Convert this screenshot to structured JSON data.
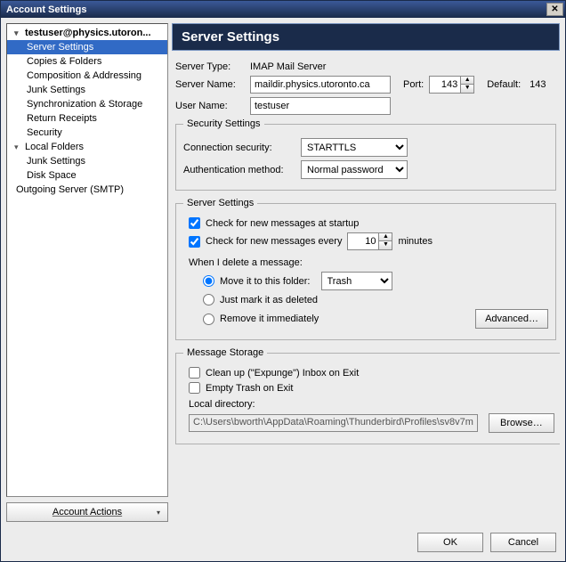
{
  "window": {
    "title": "Account Settings",
    "close": "✕"
  },
  "sidebar": {
    "items": [
      {
        "label": "testuser@physics.utoron...",
        "parent": true
      },
      {
        "label": "Server Settings",
        "selected": true
      },
      {
        "label": "Copies & Folders"
      },
      {
        "label": "Composition & Addressing"
      },
      {
        "label": "Junk Settings"
      },
      {
        "label": "Synchronization & Storage"
      },
      {
        "label": "Return Receipts"
      },
      {
        "label": "Security"
      },
      {
        "label": "Local Folders",
        "parent": true
      },
      {
        "label": "Junk Settings"
      },
      {
        "label": "Disk Space"
      },
      {
        "label": "Outgoing Server (SMTP)",
        "top": true
      }
    ],
    "account_actions": "Account Actions"
  },
  "panel": {
    "title": "Server Settings",
    "server_type_label": "Server Type:",
    "server_type_value": "IMAP Mail Server",
    "server_name_label": "Server Name:",
    "server_name_value": "maildir.physics.utoronto.ca",
    "port_label": "Port:",
    "port_value": "143",
    "default_label": "Default:",
    "default_value": "143",
    "user_name_label": "User Name:",
    "user_name_value": "testuser",
    "security": {
      "legend": "Security Settings",
      "conn_label": "Connection security:",
      "conn_value": "STARTTLS",
      "auth_label": "Authentication method:",
      "auth_value": "Normal password"
    },
    "server": {
      "legend": "Server Settings",
      "check_startup": "Check for new messages at startup",
      "check_every_prefix": "Check for new messages every",
      "check_every_value": "10",
      "check_every_suffix": "minutes",
      "delete_label": "When I delete a message:",
      "opt_move": "Move it to this folder:",
      "opt_move_value": "Trash",
      "opt_mark": "Just mark it as deleted",
      "opt_remove": "Remove it immediately",
      "advanced": "Advanced…"
    },
    "storage": {
      "legend": "Message Storage",
      "expunge": "Clean up (\"Expunge\") Inbox on Exit",
      "empty_trash": "Empty Trash on Exit",
      "local_dir_label": "Local directory:",
      "local_dir_value": "C:\\Users\\bworth\\AppData\\Roaming\\Thunderbird\\Profiles\\sv8v7m",
      "browse": "Browse…"
    }
  },
  "footer": {
    "ok": "OK",
    "cancel": "Cancel"
  }
}
